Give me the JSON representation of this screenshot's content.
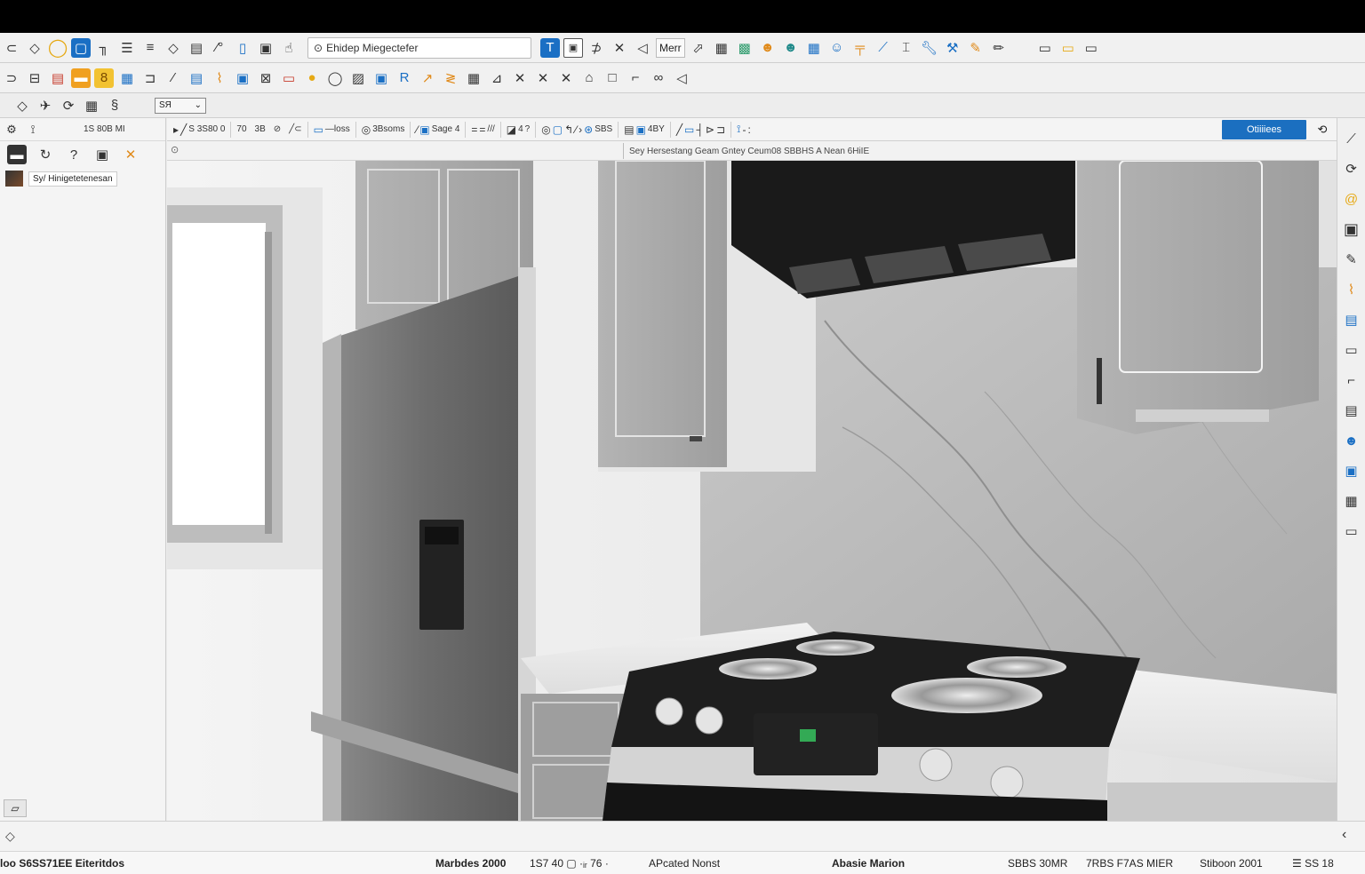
{
  "toolbar_top": {
    "search_value": "Ehidep Miegectefer",
    "label_button": "Merr"
  },
  "toolbar_mid": {
    "small_field": "SЯ"
  },
  "options_bar": {
    "coord_label": "S 3S80 0",
    "items": [
      "70",
      "3B",
      "⊘",
      "╱⊂",
      "—loss",
      "3Bsoms",
      "Sage 4",
      "///",
      "4",
      "?",
      "SBS",
      "4BY"
    ],
    "highlight_button": "Otiiiiees"
  },
  "left_panel": {
    "coord": "1S 80B MI",
    "layer_label": "Sy/ Hinigetetenesan"
  },
  "viewport": {
    "caption": "Sey Hersestang Geam Gntey Ceum08 SBBHS A Nean 6HiIE"
  },
  "status_bar": {
    "left": "loo S6SS71EE Eiteritdos",
    "mode": "Marbdes 2000",
    "values": "1S7 40 ▢ ·ᵢᵣ 76 ·",
    "selection": "APcated Nonst",
    "material": "Abasie Marion",
    "count": "SBBS 30MR",
    "units": "7RBS F7AS MIER",
    "stamp": "Stiboon 2001",
    "zoom": "☰ SS 18"
  },
  "icons": {
    "top_row": [
      "cursor-icon",
      "diamond-icon",
      "circle-icon",
      "square-blue-icon",
      "pin-icon",
      "list-icon",
      "lines-icon",
      "diamond-outline-icon",
      "stack-icon",
      "pen-icon",
      "rect-icon",
      "doc-icon",
      "hand-icon"
    ],
    "colors": {
      "accent_blue": "#1b6fc0",
      "orange": "#e08a1a",
      "yellow": "#f2c232"
    }
  }
}
